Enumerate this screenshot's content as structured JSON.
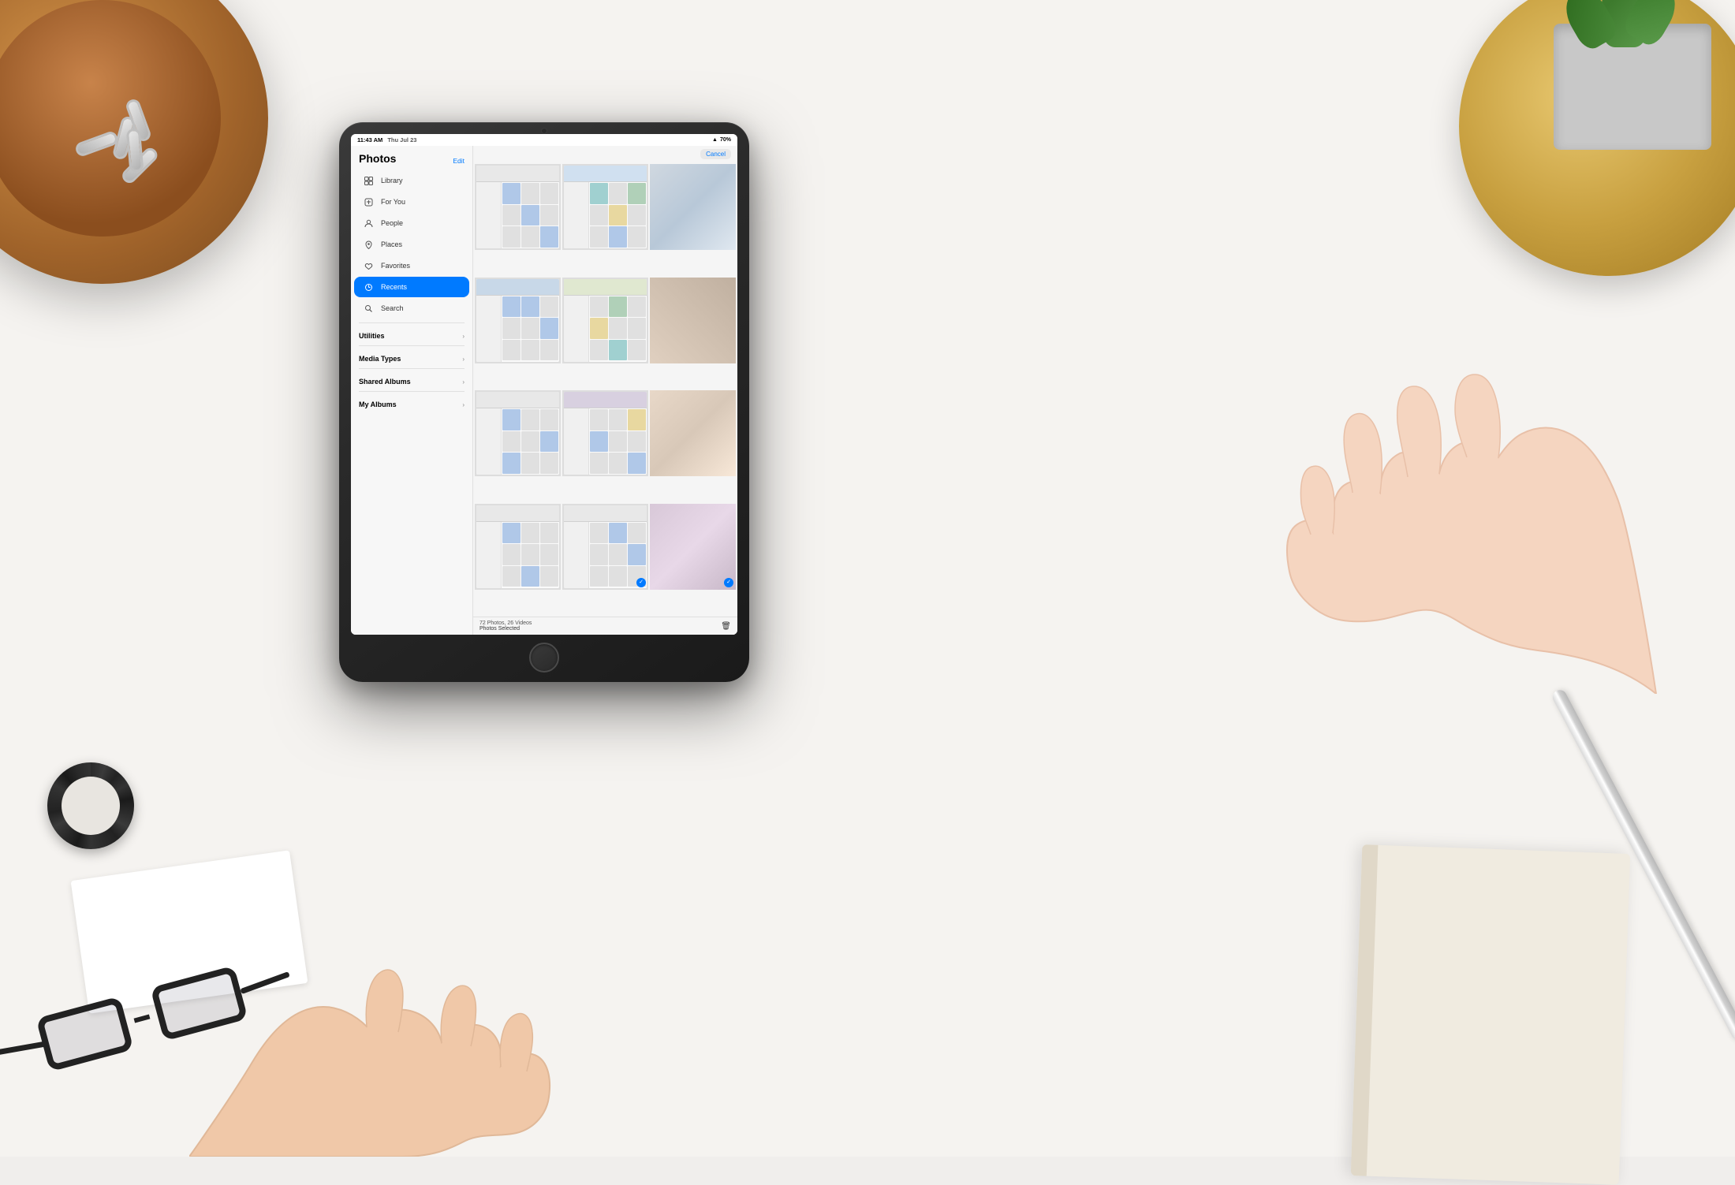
{
  "desk": {
    "background_color": "#f5f3f0"
  },
  "ipad": {
    "status_bar": {
      "time": "11:43 AM",
      "date": "Thu Jul 23",
      "battery": "70%",
      "battery_icon": "🔋"
    },
    "sidebar": {
      "title": "Photos",
      "edit_label": "Edit",
      "nav_items": [
        {
          "id": "library",
          "label": "Library",
          "icon": "⊞",
          "active": false
        },
        {
          "id": "for-you",
          "label": "For You",
          "icon": "❤",
          "active": false
        },
        {
          "id": "people",
          "label": "People",
          "icon": "👤",
          "active": false
        },
        {
          "id": "places",
          "label": "Places",
          "icon": "📍",
          "active": false
        },
        {
          "id": "favorites",
          "label": "Favorites",
          "icon": "♡",
          "active": false
        },
        {
          "id": "recents",
          "label": "Recents",
          "icon": "🕐",
          "active": true
        },
        {
          "id": "search",
          "label": "Search",
          "icon": "🔍",
          "active": false
        }
      ],
      "sections": [
        {
          "id": "utilities",
          "label": "Utilities",
          "expanded": false
        },
        {
          "id": "media-types",
          "label": "Media Types",
          "expanded": false
        },
        {
          "id": "shared-albums",
          "label": "Shared Albums",
          "expanded": false
        },
        {
          "id": "my-albums",
          "label": "My Albums",
          "expanded": false
        }
      ]
    },
    "content": {
      "cancel_label": "Cancel",
      "photo_count": "72 Photos, 26 Videos",
      "photos_selected": "Photos Selected",
      "photos": [
        {
          "id": 1,
          "class": "p1",
          "selected": false,
          "is_screenshot": true
        },
        {
          "id": 2,
          "class": "p2",
          "selected": false,
          "is_screenshot": true
        },
        {
          "id": 3,
          "class": "p3",
          "selected": false,
          "is_screenshot": false
        },
        {
          "id": 4,
          "class": "p4",
          "selected": false,
          "is_screenshot": true
        },
        {
          "id": 5,
          "class": "p5",
          "selected": false,
          "is_screenshot": true
        },
        {
          "id": 6,
          "class": "p6",
          "selected": false,
          "is_screenshot": false
        },
        {
          "id": 7,
          "class": "p7",
          "selected": false,
          "is_screenshot": true
        },
        {
          "id": 8,
          "class": "p8",
          "selected": false,
          "is_screenshot": true
        },
        {
          "id": 9,
          "class": "p9",
          "selected": false,
          "is_screenshot": false
        },
        {
          "id": 10,
          "class": "p10",
          "selected": false,
          "is_screenshot": true
        },
        {
          "id": 11,
          "class": "p11",
          "selected": true,
          "is_screenshot": true
        },
        {
          "id": 12,
          "class": "p12",
          "selected": true,
          "is_screenshot": false
        }
      ]
    }
  }
}
